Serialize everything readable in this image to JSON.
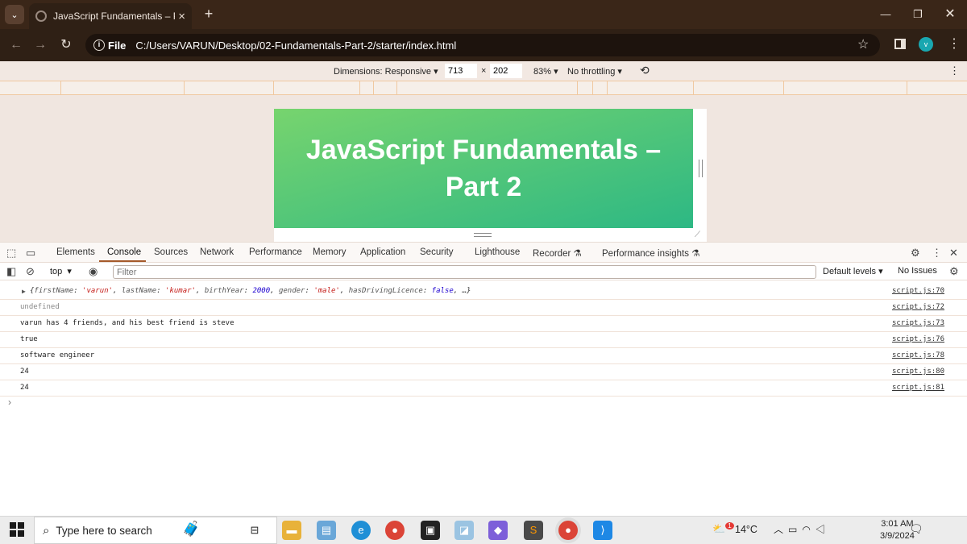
{
  "browser": {
    "tab_title": "JavaScript Fundamentals – Part",
    "url_chip": "File",
    "url": "C:/Users/VARUN/Desktop/02-Fundamentals-Part-2/starter/index.html",
    "avatar_letter": "v"
  },
  "device_toolbar": {
    "dimensions_label": "Dimensions: Responsive",
    "width": "713",
    "times": "×",
    "height": "202",
    "zoom": "83%",
    "throttling": "No throttling"
  },
  "page": {
    "heading": "JavaScript Fundamentals – Part 2"
  },
  "devtools": {
    "tabs": [
      "Elements",
      "Console",
      "Sources",
      "Network",
      "Performance",
      "Memory",
      "Application",
      "Security",
      "Lighthouse",
      "Recorder",
      "Performance insights"
    ],
    "context": "top",
    "filter_placeholder": "Filter",
    "levels": "Default levels",
    "issues": "No Issues"
  },
  "console": {
    "rows": [
      {
        "kind": "object",
        "text": "{firstName: 'varun', lastName: 'kumar', birthYear: 2000, gender: 'male', hasDrivingLicence: false, …}",
        "source": "script.js:70"
      },
      {
        "kind": "undefined",
        "text": "undefined",
        "source": "script.js:72"
      },
      {
        "kind": "log",
        "text": "varun has 4 friends, and his best friend is steve",
        "source": "script.js:73"
      },
      {
        "kind": "log",
        "text": "true",
        "source": "script.js:76"
      },
      {
        "kind": "log",
        "text": "software engineer",
        "source": "script.js:78"
      },
      {
        "kind": "log",
        "text": "24",
        "source": "script.js:80"
      },
      {
        "kind": "log",
        "text": "24",
        "source": "script.js:81"
      }
    ],
    "object_parts": {
      "k1": "firstName",
      "v1": "'varun'",
      "k2": "lastName",
      "v2": "'kumar'",
      "k3": "birthYear",
      "v3": "2000",
      "k4": "gender",
      "v4": "'male'",
      "k5": "hasDrivingLicence",
      "v5": "false"
    }
  },
  "taskbar": {
    "search_placeholder": "Type here to search",
    "weather_badge": "1",
    "temperature": "14°C",
    "time": "3:01 AM",
    "date": "3/9/2024"
  },
  "colors": {
    "titlebar": "#3a2618",
    "banner_start": "#77d46e",
    "banner_end": "#2db884",
    "console_underline": "#a55a2a"
  }
}
